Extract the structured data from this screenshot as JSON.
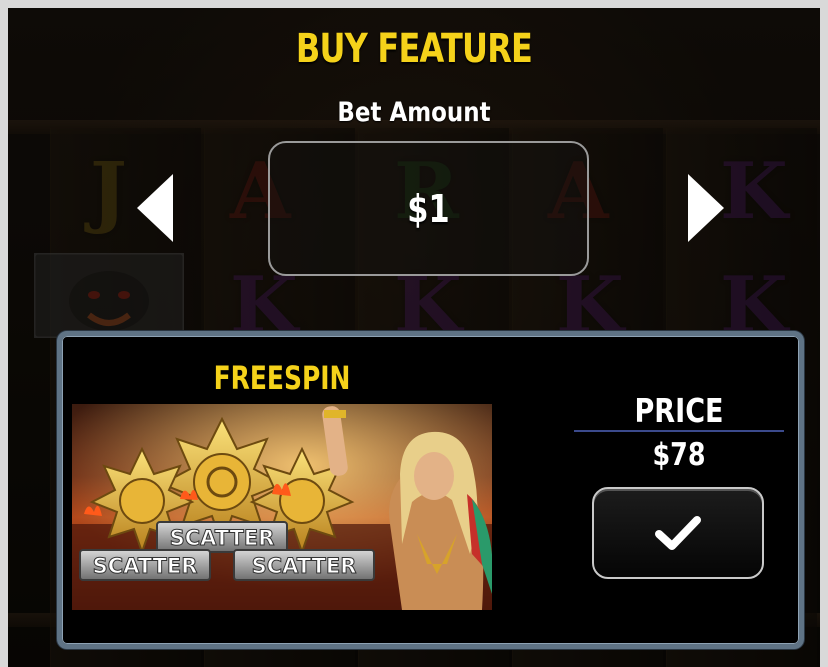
{
  "dialog": {
    "title": "BUY FEATURE",
    "bet_label": "Bet Amount",
    "bet_value": "$1"
  },
  "feature": {
    "name": "FREESPIN",
    "price_label": "PRICE",
    "price_value": "$78",
    "art_text": [
      "SCATTER",
      "SCATTER",
      "SCATTER"
    ]
  },
  "background_letters": [
    "J",
    "A",
    "R",
    "A",
    "K",
    "K",
    "K",
    "K",
    "K"
  ],
  "colors": {
    "title_yellow": "#f5d21a",
    "card_border": "#5f7385",
    "price_divider": "#3b4a8c"
  }
}
